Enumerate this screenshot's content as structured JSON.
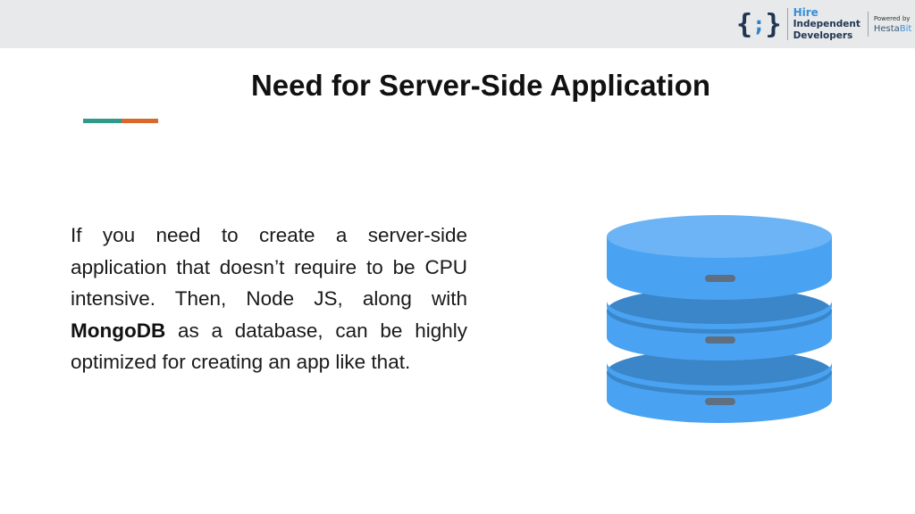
{
  "header": {
    "logo": {
      "braces_icon": "{;}",
      "line1": "Hire",
      "line2": "Independent",
      "line3": "Developers",
      "powered_by": "Powered by",
      "brand_prefix": "Hesta",
      "brand_suffix": "Bit"
    }
  },
  "slide": {
    "title": "Need for Server-Side Application",
    "accent_colors": {
      "left": "#2f9a8a",
      "right": "#d8692a"
    },
    "paragraph": {
      "before": "If you need to create a server-side application that doesn’t require to be CPU intensive. Then, Node JS, along with ",
      "bold": "MongoDB",
      "after": " as a database, can be highly optimized for creating an app like that."
    },
    "illustration": {
      "icon": "database-icon",
      "colors": {
        "top": "#6cb4f5",
        "body": "#4aa3f2",
        "band": "#3a86c8",
        "slot": "#5f6f7f"
      }
    }
  }
}
